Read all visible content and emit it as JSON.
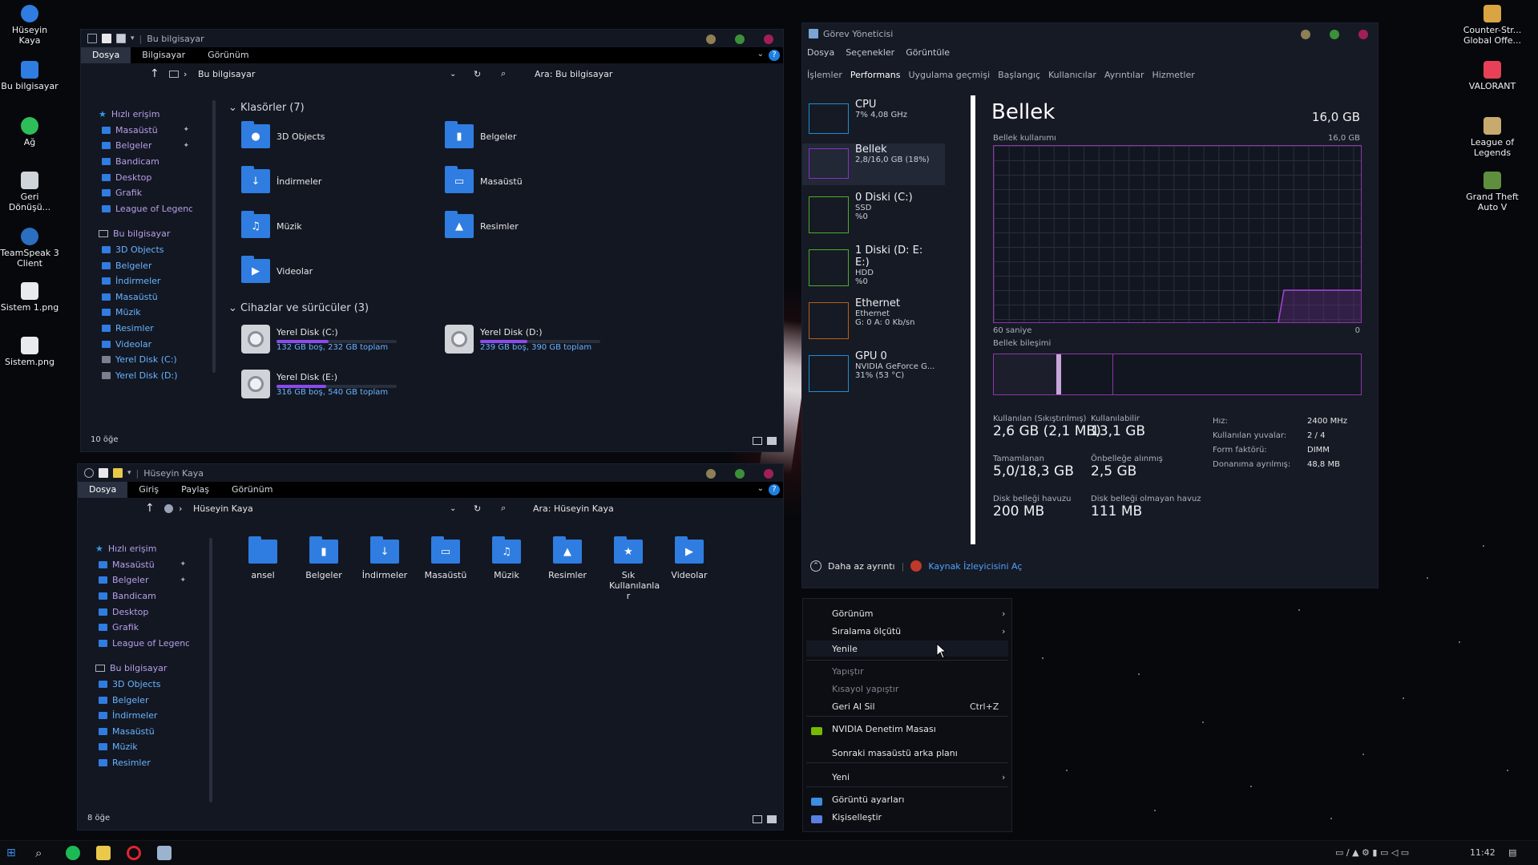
{
  "desktop": {
    "left_icons": [
      "Hüseyin Kaya",
      "Bu bilgisayar",
      "Ağ",
      "Geri Dönüşü...",
      "TeamSpeak 3 Client",
      "Sistem 1.png",
      "Sistem.png"
    ],
    "right_icons": [
      "Counter-Str... Global Offe...",
      "VALORANT",
      "League of Legends",
      "Grand Theft Auto V"
    ]
  },
  "explorer1": {
    "title": "Bu bilgisayar",
    "ribbon_tabs": [
      "Dosya",
      "Bilgisayar",
      "Görünüm"
    ],
    "address": "Bu bilgisayar",
    "search_placeholder": "Ara: Bu bilgisayar",
    "quick_access": "Hızlı erişim",
    "quick_items": [
      "Masaüstü",
      "Belgeler",
      "Bandicam",
      "Desktop",
      "Grafik",
      "League of Legends"
    ],
    "this_pc": "Bu bilgisayar",
    "pc_items": [
      "3D Objects",
      "Belgeler",
      "İndirmeler",
      "Masaüstü",
      "Müzik",
      "Resimler",
      "Videolar",
      "Yerel Disk (C:)",
      "Yerel Disk (D:)"
    ],
    "folders_group": "Klasörler (7)",
    "folders": [
      "3D Objects",
      "Belgeler",
      "İndirmeler",
      "Masaüstü",
      "Müzik",
      "Resimler",
      "Videolar"
    ],
    "devices_group": "Cihazlar ve sürücüler (3)",
    "drives": [
      {
        "name": "Yerel Disk (C:)",
        "info": "132 GB boş, 232 GB toplam",
        "used": 0.43
      },
      {
        "name": "Yerel Disk (D:)",
        "info": "239 GB boş, 390 GB toplam",
        "used": 0.39
      },
      {
        "name": "Yerel Disk (E:)",
        "info": "316 GB boş, 540 GB toplam",
        "used": 0.41
      }
    ],
    "status": "10 öğe"
  },
  "explorer2": {
    "title": "Hüseyin Kaya",
    "ribbon_tabs": [
      "Dosya",
      "Giriş",
      "Paylaş",
      "Görünüm"
    ],
    "address": "Hüseyin Kaya",
    "search_placeholder": "Ara: Hüseyin Kaya",
    "quick_access": "Hızlı erişim",
    "quick_items": [
      "Masaüstü",
      "Belgeler",
      "Bandicam",
      "Desktop",
      "Grafik",
      "League of Legends"
    ],
    "this_pc": "Bu bilgisayar",
    "pc_items": [
      "3D Objects",
      "Belgeler",
      "İndirmeler",
      "Masaüstü",
      "Müzik",
      "Resimler"
    ],
    "folders": [
      "ansel",
      "Belgeler",
      "İndirmeler",
      "Masaüstü",
      "Müzik",
      "Resimler",
      "Sık Kullanılanla r",
      "Videolar"
    ],
    "status": "8 öğe"
  },
  "taskmgr": {
    "title": "Görev Yöneticisi",
    "menu": [
      "Dosya",
      "Seçenekler",
      "Görüntüle"
    ],
    "tabs": [
      "İşlemler",
      "Performans",
      "Uygulama geçmişi",
      "Başlangıç",
      "Kullanıcılar",
      "Ayrıntılar",
      "Hizmetler"
    ],
    "perf_items": [
      {
        "name": "CPU",
        "l1": "7% 4,08 GHz",
        "l2": "",
        "color": "#1a8fd6"
      },
      {
        "name": "Bellek",
        "l1": "2,8/16,0 GB (18%)",
        "l2": "",
        "color": "#8b2fc9"
      },
      {
        "name": "0 Diski (C:)",
        "l1": "SSD",
        "l2": "%0",
        "color": "#4caf2a"
      },
      {
        "name": "1 Diski (D: E: E:)",
        "l1": "HDD",
        "l2": "%0",
        "color": "#4caf2a"
      },
      {
        "name": "Ethernet",
        "l1": "Ethernet",
        "l2": "G: 0 A: 0 Kb/sn",
        "color": "#b85f1a"
      },
      {
        "name": "GPU 0",
        "l1": "NVIDIA GeForce G...",
        "l2": "31% (53 °C)",
        "color": "#1a8fd6"
      }
    ],
    "heading": "Bellek",
    "total": "16,0 GB",
    "usage_label": "Bellek kullanımı",
    "usage_max": "16,0 GB",
    "time_left": "60 saniye",
    "time_right": "0",
    "composition": "Bellek bileşimi",
    "stats": [
      {
        "label": "Kullanılan (Sıkıştırılmış)",
        "value": "2,6 GB (2,1 MB)"
      },
      {
        "label": "Kullanılabilir",
        "value": "13,1 GB"
      },
      {
        "label": "Tamamlanan",
        "value": "5,0/18,3 GB"
      },
      {
        "label": "Önbelleğe alınmış",
        "value": "2,5 GB"
      },
      {
        "label": "Disk belleği havuzu",
        "value": "200 MB"
      },
      {
        "label": "Disk belleği olmayan havuz",
        "value": "111 MB"
      }
    ],
    "specs": [
      {
        "k": "Hız:",
        "v": "2400 MHz"
      },
      {
        "k": "Kullanılan yuvalar:",
        "v": "2 / 4"
      },
      {
        "k": "Form faktörü:",
        "v": "DIMM"
      },
      {
        "k": "Donanıma ayrılmış:",
        "v": "48,8 MB"
      }
    ],
    "fewer": "Daha az ayrıntı",
    "resmon": "Kaynak İzleyicisini Aç"
  },
  "context_menu": {
    "items": [
      {
        "label": "Görünüm",
        "sub": true
      },
      {
        "label": "Sıralama ölçütü",
        "sub": true
      },
      {
        "label": "Yenile"
      },
      {
        "label": "Yapıştır",
        "dim": true
      },
      {
        "label": "Kısayol yapıştır",
        "dim": true
      },
      {
        "label": "Geri Al Sil",
        "key": "Ctrl+Z"
      },
      {
        "label": "NVIDIA Denetim Masası"
      },
      {
        "label": "Sonraki masaüstü arka planı"
      },
      {
        "label": "Yeni",
        "sub": true
      },
      {
        "label": "Görüntü ayarları"
      },
      {
        "label": "Kişiselleştir"
      }
    ]
  },
  "taskbar": {
    "time": "11:42"
  }
}
